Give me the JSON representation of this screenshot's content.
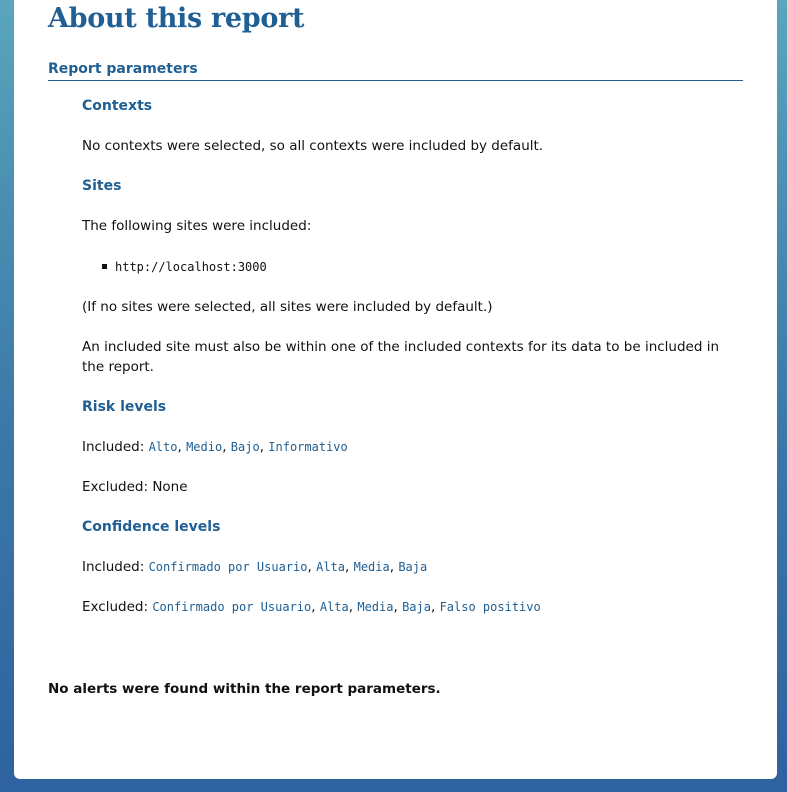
{
  "page": {
    "title": "About this report",
    "section_title": "Report parameters",
    "final_message": "No alerts were found within the report parameters."
  },
  "contexts": {
    "heading": "Contexts",
    "text": "No contexts were selected, so all contexts were included by default."
  },
  "sites": {
    "heading": "Sites",
    "intro": "The following sites were included:",
    "list": [
      "http://localhost:3000"
    ],
    "default_note": "(If no sites were selected, all sites were included by default.)",
    "context_note": "An included site must also be within one of the included contexts for its data to be included in the report."
  },
  "risk": {
    "heading": "Risk levels",
    "included_label": "Included:",
    "included": [
      "Alto",
      "Medio",
      "Bajo",
      "Informativo"
    ],
    "excluded_label": "Excluded:",
    "excluded_text": "None"
  },
  "confidence": {
    "heading": "Confidence levels",
    "included_label": "Included:",
    "included": [
      "Confirmado por Usuario",
      "Alta",
      "Media",
      "Baja"
    ],
    "excluded_label": "Excluded:",
    "excluded": [
      "Confirmado por Usuario",
      "Alta",
      "Media",
      "Baja",
      "Falso positivo"
    ]
  },
  "colors": {
    "accent": "#1f5f93",
    "text": "#111111",
    "background_top": "#5aa6bd",
    "background_bottom": "#2e62a0"
  }
}
